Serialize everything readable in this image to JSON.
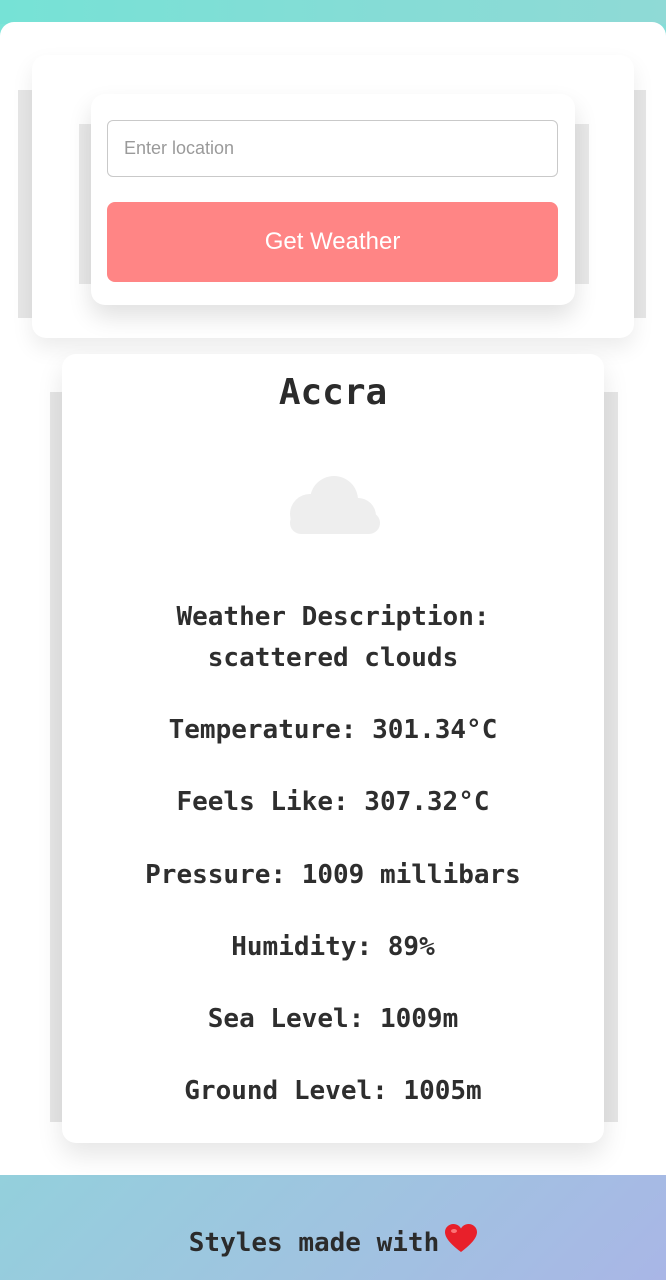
{
  "search": {
    "placeholder": "Enter location",
    "value": "",
    "button_label": "Get Weather"
  },
  "weather": {
    "city": "Accra",
    "icon": "cloud-icon",
    "description_label": "Weather Description:",
    "description_value": "scattered clouds",
    "temperature": "Temperature: 301.34°C",
    "feels_like": "Feels Like: 307.32°C",
    "pressure": "Pressure: 1009 millibars",
    "humidity": "Humidity: 89%",
    "sea_level": "Sea Level: 1009m",
    "ground_level": "Ground Level: 1005m"
  },
  "footer": {
    "text": "Styles made with",
    "icon": "heart-icon"
  },
  "colors": {
    "button": "#ff8585",
    "gradient_start": "#7be4d8",
    "gradient_end": "#a9b6e6",
    "heart": "#e8202a"
  }
}
